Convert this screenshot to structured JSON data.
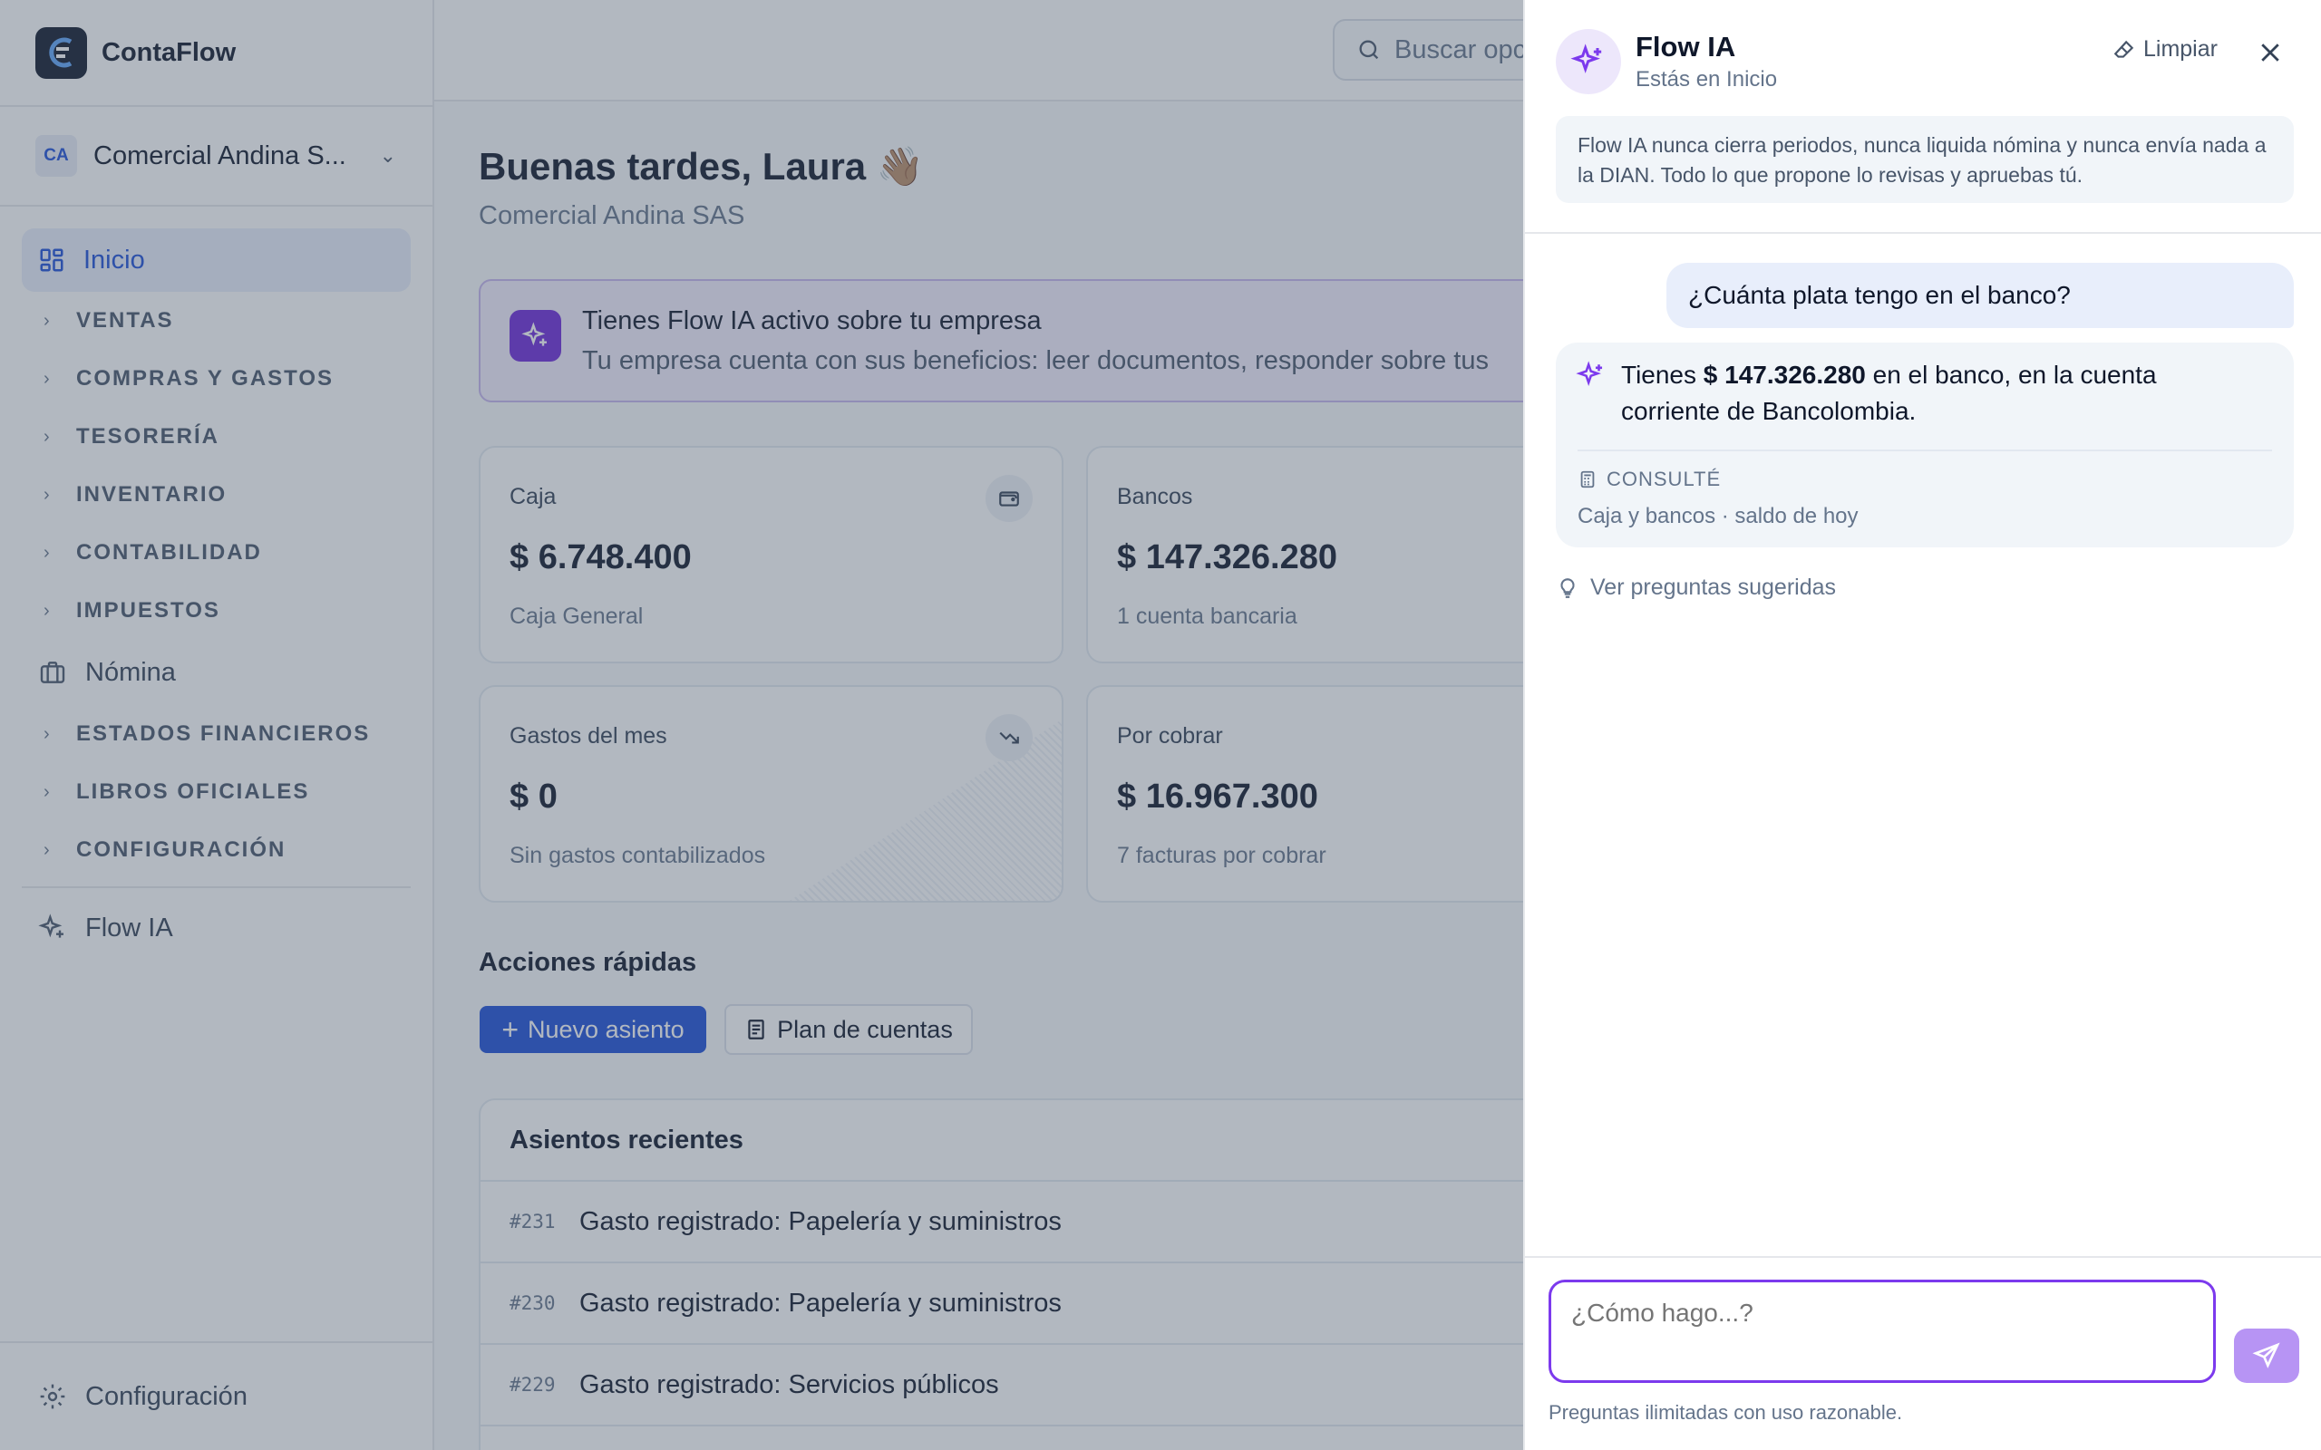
{
  "app": {
    "name": "ContaFlow"
  },
  "sidebar": {
    "company": {
      "initials": "CA",
      "name": "Comercial Andina S..."
    },
    "home_label": "Inicio",
    "groups": [
      "VENTAS",
      "COMPRAS Y GASTOS",
      "TESORERÍA",
      "INVENTARIO",
      "CONTABILIDAD",
      "IMPUESTOS"
    ],
    "payroll_label": "Nómina",
    "groups2": [
      "ESTADOS FINANCIEROS",
      "LIBROS OFICIALES",
      "CONFIGURACIÓN"
    ],
    "flow_label": "Flow IA",
    "footer_label": "Configuración"
  },
  "topbar": {
    "search_placeholder": "Buscar opc"
  },
  "home": {
    "greeting": "Buenas tardes, Laura 👋🏽",
    "company": "Comercial Andina SAS",
    "banner": {
      "title": "Tienes Flow IA activo sobre tu empresa",
      "text": "Tu empresa cuenta con sus beneficios: leer documentos, responder sobre tus"
    },
    "cards": [
      {
        "label": "Caja",
        "value": "$ 6.748.400",
        "sub": "Caja General",
        "icon": "wallet-icon"
      },
      {
        "label": "Bancos",
        "value": "$ 147.326.280",
        "sub": "1 cuenta bancaria"
      },
      {
        "label": "Gastos del mes",
        "value": "$ 0",
        "sub": "Sin gastos contabilizados",
        "icon": "trend-down-icon"
      },
      {
        "label": "Por cobrar",
        "value": "$ 16.967.300",
        "sub": "7 facturas por cobrar"
      }
    ],
    "quick_actions": {
      "title": "Acciones rápidas",
      "new_entry": "Nuevo asiento",
      "chart_of_accounts": "Plan de cuentas"
    },
    "recent": {
      "title": "Asientos recientes",
      "rows": [
        {
          "num": "#231",
          "desc": "Gasto registrado: Papelería y suministros"
        },
        {
          "num": "#230",
          "desc": "Gasto registrado: Papelería y suministros"
        },
        {
          "num": "#229",
          "desc": "Gasto registrado: Servicios públicos"
        }
      ]
    }
  },
  "assistant": {
    "title": "Flow IA",
    "subtitle": "Estás en Inicio",
    "clear_label": "Limpiar",
    "notice": "Flow IA nunca cierra periodos, nunca liquida nómina y nunca envía nada a la DIAN. Todo lo que propone lo revisas y apruebas tú.",
    "user_message": "¿Cuánta plata tengo en el banco?",
    "reply": {
      "pre": "Tienes ",
      "amount": "$ 147.326.280",
      "post": " en el banco, en la cuenta corriente de Bancolombia."
    },
    "source_heading": "CONSULTÉ",
    "source_text": "Caja y bancos · saldo de hoy",
    "suggest_label": "Ver preguntas sugeridas",
    "input_placeholder": "¿Cómo hago...?",
    "footnote": "Preguntas ilimitadas con uso razonable."
  },
  "colors": {
    "accent": "#1d4ed8",
    "ai_purple": "#7c3aed",
    "overlay": "#475569"
  }
}
